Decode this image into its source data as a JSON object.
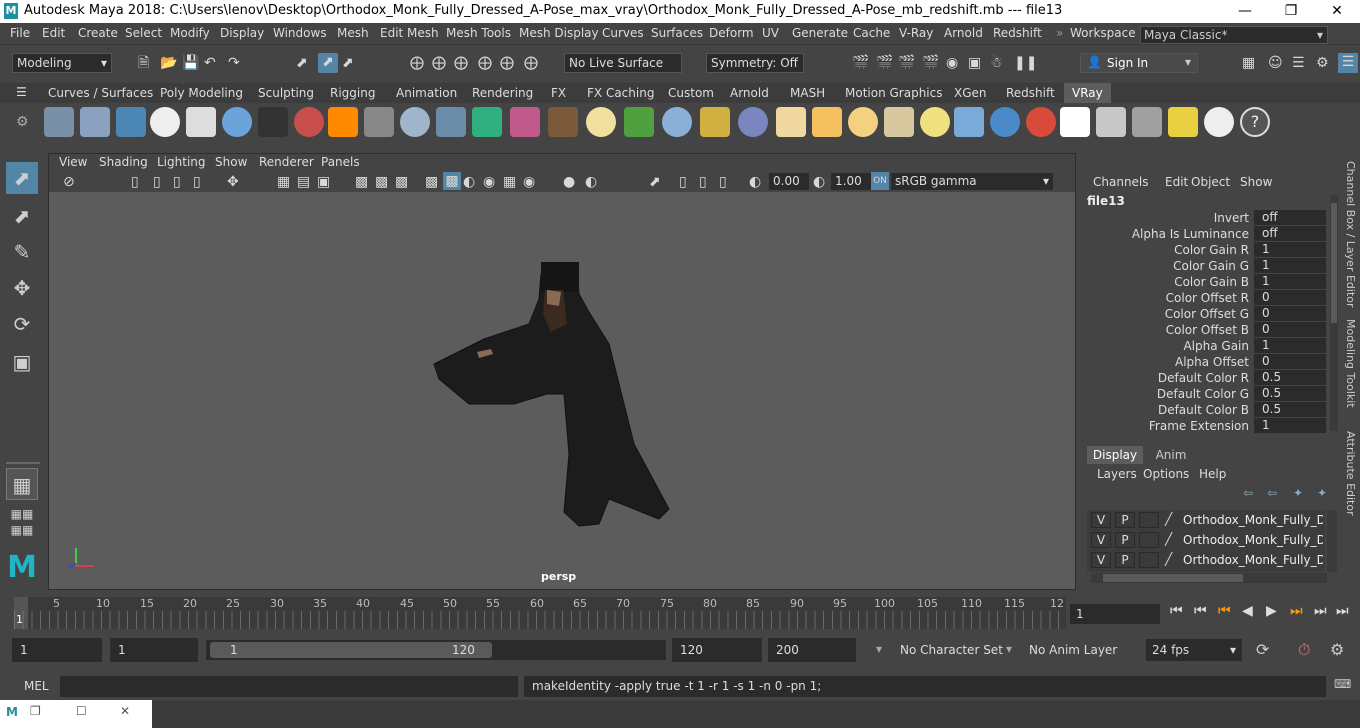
{
  "window": {
    "title": "Autodesk Maya 2018: C:\\Users\\lenov\\Desktop\\Orthodox_Monk_Fully_Dressed_A-Pose_max_vray\\Orthodox_Monk_Fully_Dressed_A-Pose_mb_redshift.mb  ---  file13",
    "logo": "M"
  },
  "menus": [
    "File",
    "Edit",
    "Create",
    "Select",
    "Modify",
    "Display",
    "Windows",
    "Mesh",
    "Edit Mesh",
    "Mesh Tools",
    "Mesh Display",
    "Curves",
    "Surfaces",
    "Deform",
    "UV",
    "Generate",
    "Cache",
    "V-Ray",
    "Arnold",
    "Redshift"
  ],
  "workspace": {
    "label": "Workspace :",
    "value": "Maya Classic*"
  },
  "status_line": {
    "menuset": "Modeling",
    "live_surface": "No Live Surface",
    "symmetry": "Symmetry: Off",
    "sign_in": "Sign In"
  },
  "shelf_tabs": [
    "Curves / Surfaces",
    "Poly Modeling",
    "Sculpting",
    "Rigging",
    "Animation",
    "Rendering",
    "FX",
    "FX Caching",
    "Custom",
    "Arnold",
    "MASH",
    "Motion Graphics",
    "XGen",
    "Redshift",
    "VRay"
  ],
  "shelf_active": "VRay",
  "viewport": {
    "menus": [
      "View",
      "Shading",
      "Lighting",
      "Show",
      "Renderer",
      "Panels"
    ],
    "exposure": "0.00",
    "gamma": "1.00",
    "color_space": "sRGB gamma",
    "camera_label": "persp"
  },
  "channel_box": {
    "menus": [
      "Channels",
      "Edit",
      "Object",
      "Show"
    ],
    "node": "file13",
    "attributes": [
      {
        "name": "Invert",
        "value": "off"
      },
      {
        "name": "Alpha Is Luminance",
        "value": "off"
      },
      {
        "name": "Color Gain R",
        "value": "1"
      },
      {
        "name": "Color Gain G",
        "value": "1"
      },
      {
        "name": "Color Gain B",
        "value": "1"
      },
      {
        "name": "Color Offset R",
        "value": "0"
      },
      {
        "name": "Color Offset G",
        "value": "0"
      },
      {
        "name": "Color Offset B",
        "value": "0"
      },
      {
        "name": "Alpha Gain",
        "value": "1"
      },
      {
        "name": "Alpha Offset",
        "value": "0"
      },
      {
        "name": "Default Color R",
        "value": "0.5"
      },
      {
        "name": "Default Color G",
        "value": "0.5"
      },
      {
        "name": "Default Color B",
        "value": "0.5"
      },
      {
        "name": "Frame Extension",
        "value": "1"
      }
    ]
  },
  "layer_editor": {
    "tabs": [
      "Display",
      "Anim"
    ],
    "menus": [
      "Layers",
      "Options",
      "Help"
    ],
    "layers": [
      {
        "v": "V",
        "p": "P",
        "name": "Orthodox_Monk_Fully_Dres"
      },
      {
        "v": "V",
        "p": "P",
        "name": "Orthodox_Monk_Fully_Dres"
      },
      {
        "v": "V",
        "p": "P",
        "name": "Orthodox_Monk_Fully_Dres"
      }
    ]
  },
  "side_tabs": [
    "Channel Box / Layer Editor",
    "Modeling Toolkit",
    "Attribute Editor"
  ],
  "timeline": {
    "ticks": [
      "1",
      "5",
      "10",
      "15",
      "20",
      "25",
      "30",
      "35",
      "40",
      "45",
      "50",
      "55",
      "60",
      "65",
      "70",
      "75",
      "80",
      "85",
      "90",
      "95",
      "100",
      "105",
      "110",
      "115",
      "12"
    ],
    "current_frame": "1"
  },
  "range": {
    "start": "1",
    "playback_start": "1",
    "slider_start": "1",
    "slider_end": "120",
    "playback_end": "120",
    "end": "200",
    "character_set": "No Character Set",
    "anim_layer": "No Anim Layer",
    "fps": "24 fps"
  },
  "command_line": {
    "label": "MEL",
    "feedback": "makeIdentity -apply true -t 1 -r 1 -s 1 -n 0 -pn 1;"
  }
}
